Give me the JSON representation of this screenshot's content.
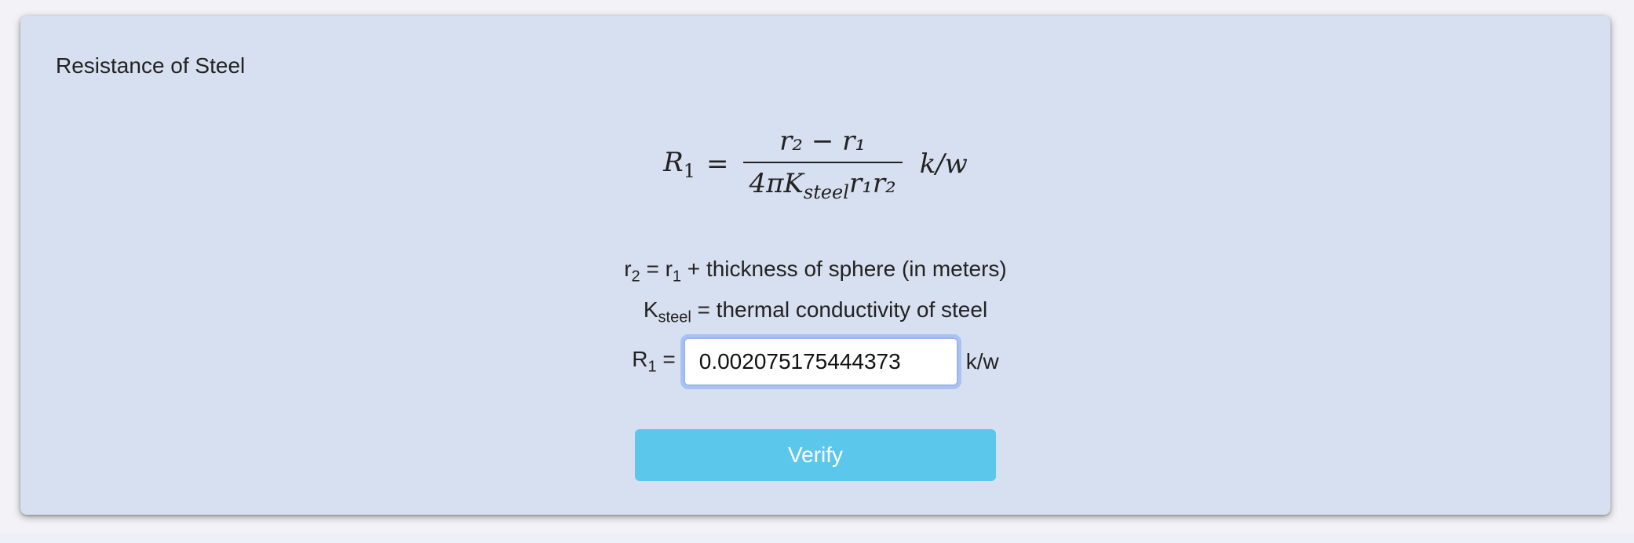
{
  "card": {
    "title": "Resistance of Steel"
  },
  "formula": {
    "lhs_symbol": "R",
    "lhs_sub": "1",
    "equals": "=",
    "numerator": "r₂ − r₁",
    "denominator_prefix": "4πK",
    "denominator_sub": "steel",
    "denominator_suffix": "r₁r₂",
    "unit": "k/w"
  },
  "descriptions": {
    "line1_symbol": "r",
    "line1_sub": "2",
    "line1_text_a": " = r",
    "line1_sub_b": "1",
    "line1_text_b": " + thickness of sphere (in meters)",
    "line2_symbol": "K",
    "line2_sub": "steel",
    "line2_text": " = thermal conductivity of steel"
  },
  "answer_row": {
    "label_symbol": "R",
    "label_sub": "1",
    "label_equals": " =",
    "value": "0.002075175444373",
    "unit": "k/w"
  },
  "verify_button": {
    "label": "Verify",
    "color": "#5bc7ea"
  },
  "colors": {
    "card_background": "#d7e0f0",
    "input_focus_ring": "#aac2f2"
  }
}
